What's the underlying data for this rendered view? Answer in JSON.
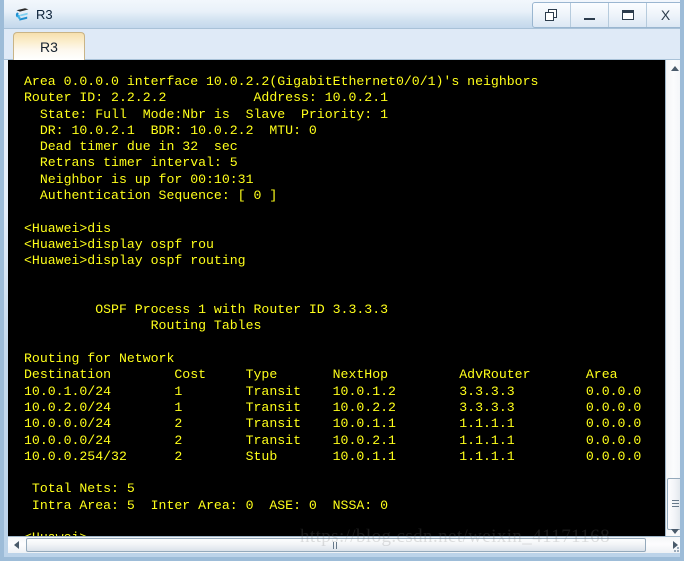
{
  "window": {
    "title": "R3",
    "icon": "router-icon",
    "controls": [
      {
        "name": "restore-cascade-button",
        "label": "Restore"
      },
      {
        "name": "minimize-button",
        "label": "Minimize"
      },
      {
        "name": "maximize-button",
        "label": "Maximize"
      },
      {
        "name": "close-button",
        "label": "X"
      }
    ]
  },
  "tabs": [
    {
      "label": "R3",
      "active": true
    }
  ],
  "terminal": {
    "foreground_color": "#ffff1a",
    "background_color": "#000000",
    "content": "Area 0.0.0.0 interface 10.0.2.2(GigabitEthernet0/0/1)'s neighbors\nRouter ID: 2.2.2.2           Address: 10.0.2.1\n  State: Full  Mode:Nbr is  Slave  Priority: 1\n  DR: 10.0.2.1  BDR: 10.0.2.2  MTU: 0\n  Dead timer due in 32  sec\n  Retrans timer interval: 5\n  Neighbor is up for 00:10:31\n  Authentication Sequence: [ 0 ]\n\n<Huawei>dis\n<Huawei>display ospf rou\n<Huawei>display ospf routing\n\n\n         OSPF Process 1 with Router ID 3.3.3.3\n                Routing Tables\n\nRouting for Network\nDestination        Cost     Type       NextHop         AdvRouter       Area\n10.0.1.0/24        1        Transit    10.0.1.2        3.3.3.3         0.0.0.0\n10.0.2.0/24        1        Transit    10.0.2.2        3.3.3.3         0.0.0.0\n10.0.0.0/24        2        Transit    10.0.1.1        1.1.1.1         0.0.0.0\n10.0.0.0/24        2        Transit    10.0.2.1        1.1.1.1         0.0.0.0\n10.0.0.254/32      2        Stub       10.0.1.1        1.1.1.1         0.0.0.0\n\n Total Nets: 5\n Intra Area: 5  Inter Area: 0  ASE: 0  NSSA: 0\n\n<Huawei>",
    "neighbor_info": {
      "area": "0.0.0.0",
      "interface_address": "10.0.2.2",
      "interface_name": "GigabitEthernet0/0/1",
      "router_id": "2.2.2.2",
      "address": "10.0.2.1",
      "state": "Full",
      "mode": "Nbr is  Slave",
      "priority": "1",
      "dr": "10.0.2.1",
      "bdr": "10.0.2.2",
      "mtu": "0",
      "dead_timer": "32",
      "retrans_timer_interval": "5",
      "neighbor_up_for": "00:10:31",
      "authentication_sequence": "[ 0 ]"
    },
    "commands": [
      "<Huawei>dis",
      "<Huawei>display ospf rou",
      "<Huawei>display ospf routing"
    ],
    "ospf_header": {
      "process_line": "OSPF Process 1 with Router ID 3.3.3.3",
      "tables_line": "Routing Tables",
      "section_label": "Routing for Network"
    },
    "routing_table": {
      "columns": [
        "Destination",
        "Cost",
        "Type",
        "NextHop",
        "AdvRouter",
        "Area"
      ],
      "rows": [
        [
          "10.0.1.0/24",
          "1",
          "Transit",
          "10.0.1.2",
          "3.3.3.3",
          "0.0.0.0"
        ],
        [
          "10.0.2.0/24",
          "1",
          "Transit",
          "10.0.2.2",
          "3.3.3.3",
          "0.0.0.0"
        ],
        [
          "10.0.0.0/24",
          "2",
          "Transit",
          "10.0.1.1",
          "1.1.1.1",
          "0.0.0.0"
        ],
        [
          "10.0.0.0/24",
          "2",
          "Transit",
          "10.0.2.1",
          "1.1.1.1",
          "0.0.0.0"
        ],
        [
          "10.0.0.254/32",
          "2",
          "Stub",
          "10.0.1.1",
          "1.1.1.1",
          "0.0.0.0"
        ]
      ]
    },
    "summary": {
      "total_nets": "5",
      "intra_area": "5",
      "inter_area": "0",
      "ase": "0",
      "nssa": "0"
    },
    "prompt": "<Huawei>"
  },
  "watermark": {
    "text": "https://blog.csdn.net/weixin_41171168"
  }
}
